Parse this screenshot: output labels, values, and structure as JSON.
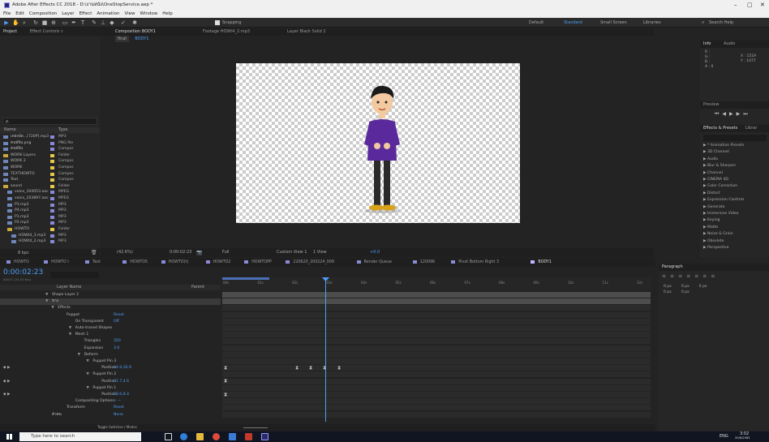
{
  "window": {
    "title": "Adobe After Effects CC 2018 - D:\\งานหนัง\\OneStopService.aep *",
    "controls": [
      "–",
      "▢",
      "✕"
    ]
  },
  "menu": [
    "File",
    "Edit",
    "Composition",
    "Layer",
    "Effect",
    "Animation",
    "View",
    "Window",
    "Help"
  ],
  "toolbar": {
    "snapping": "Snapping",
    "workspaces": [
      "Default",
      "Standard",
      "Small Screen",
      "Libraries"
    ],
    "search": "Search Help"
  },
  "project_panel": {
    "title": "Project",
    "effect_controls": "Effect Controls ร",
    "search_placeholder": "ρ.",
    "columns": [
      "Name",
      "Type"
    ],
    "items": [
      {
        "name": "เหล่งนัด...[720P].mp3",
        "type": "MP3",
        "color": "#8a8ad6",
        "indent": 0
      },
      {
        "name": "คนท์ลิน.png",
        "type": "PNG file",
        "color": "#8a8ad6",
        "indent": 0
      },
      {
        "name": "คนท์ลิน",
        "type": "Compos",
        "color": "#8a8ad6",
        "indent": 0
      },
      {
        "name": "WORK Layers",
        "type": "Folder",
        "color": "#e6c84a",
        "indent": 0
      },
      {
        "name": "WORK 2",
        "type": "Compos",
        "color": "#e6c84a",
        "indent": 0
      },
      {
        "name": "WORK",
        "type": "Compos",
        "color": "#e6c84a",
        "indent": 0
      },
      {
        "name": "TEXTHOWTO",
        "type": "Compos",
        "color": "#e6c84a",
        "indent": 0
      },
      {
        "name": "Text",
        "type": "Compos",
        "color": "#e6c84a",
        "indent": 0
      },
      {
        "name": "sound",
        "type": "Folder",
        "color": "#e6c84a",
        "indent": 0
      },
      {
        "name": "voice_104053.aac",
        "type": "MPEG",
        "color": "#8a8ad6",
        "indent": 1
      },
      {
        "name": "voice_103897.aac",
        "type": "MPEG",
        "color": "#8a8ad6",
        "indent": 1
      },
      {
        "name": "P3.mp3",
        "type": "MP3",
        "color": "#8a8ad6",
        "indent": 1
      },
      {
        "name": "P4.mp3",
        "type": "MP3",
        "color": "#8a8ad6",
        "indent": 1
      },
      {
        "name": "P1.mp3",
        "type": "MP3",
        "color": "#8a8ad6",
        "indent": 1
      },
      {
        "name": "P2.mp3",
        "type": "MP3",
        "color": "#8a8ad6",
        "indent": 1
      },
      {
        "name": "HOWTO",
        "type": "Folder",
        "color": "#e6c84a",
        "indent": 1
      },
      {
        "name": "HOWt4_3.mp3",
        "type": "MP3",
        "color": "#8a8ad6",
        "indent": 2
      },
      {
        "name": "HOWt4_2.mp3",
        "type": "MP3",
        "color": "#8a8ad6",
        "indent": 2
      }
    ],
    "bpc": "8 bpc"
  },
  "comp_viewer": {
    "tabs": [
      "Composition BODY1",
      "Footage HOWt4_2.mp3",
      "Layer Black Solid 2"
    ],
    "breadcrumb": [
      "final",
      "BODY1"
    ],
    "footer": {
      "zoom": "(42.6%)",
      "timecode": "0:00:02:23",
      "resolution": "Full",
      "view": "Custom View 1",
      "views": "1 View",
      "offset": "+0.0"
    }
  },
  "right_panel": {
    "info": "Info",
    "audio": "Audio",
    "rgb": [
      "R :",
      "G :",
      "B :",
      "A : 0"
    ],
    "xy": [
      "X : 1519",
      "Y : 1077"
    ],
    "preview": "Preview",
    "effects_presets": "Effects & Presets",
    "libraries": "Librar",
    "effects": [
      "* Animation Presets",
      "3D Channel",
      "Audio",
      "Blur & Sharpen",
      "Channel",
      "CINEMA 4D",
      "Color Correction",
      "Distort",
      "Expression Controls",
      "Generate",
      "Immersive Video",
      "Keying",
      "Matte",
      "Noise & Grain",
      "Obsolete",
      "Perspective"
    ],
    "paragraph": "Paragraph",
    "para_values": [
      "0 px",
      "0 px",
      "0 px",
      "0 px",
      "0 px"
    ]
  },
  "timeline": {
    "tabs": [
      "HOWTO",
      "HOWTO I",
      "Text",
      "HOWTO5",
      "HOWTO(t)",
      "HOWTO2",
      "HOWTOPP",
      "220620_200224_009",
      "Render Queue",
      "120096",
      "Pivot Bottom Right 3",
      "BODY1"
    ],
    "timecode": "0:00:02:23",
    "fps": "00071 (25.00 fps)",
    "col_layer": "Layer Name",
    "col_parent": "Parent",
    "ticks": [
      "00s",
      "01s",
      "02s",
      "03s",
      "04s",
      "05s",
      "06s",
      "07s",
      "08s",
      "09s",
      "10s",
      "11s",
      "12s"
    ],
    "rows": [
      {
        "label": "Shape Layer 2",
        "indent": 20,
        "value": "",
        "kf": false
      },
      {
        "label": "ขาง",
        "indent": 20,
        "value": "",
        "kf": false,
        "sel": true
      },
      {
        "label": "Effects",
        "indent": 24,
        "value": "",
        "kf": false
      },
      {
        "label": "Puppet",
        "indent": 30,
        "value": "Reset",
        "kf": false
      },
      {
        "label": "On Transparent",
        "indent": 36,
        "value": "Off",
        "kf": false
      },
      {
        "label": "Auto-traced Shapes",
        "indent": 36,
        "value": "",
        "kf": false
      },
      {
        "label": "Mesh 1",
        "indent": 36,
        "value": "",
        "kf": false
      },
      {
        "label": "Triangles",
        "indent": 42,
        "value": "350",
        "kf": false
      },
      {
        "label": "Expansion",
        "indent": 42,
        "value": "3.0",
        "kf": false
      },
      {
        "label": "Deform",
        "indent": 42,
        "value": "",
        "kf": false
      },
      {
        "label": "Puppet Pin 3",
        "indent": 48,
        "value": "",
        "kf": false
      },
      {
        "label": "Position",
        "indent": 54,
        "value": "44.9,26.9",
        "kf": true
      },
      {
        "label": "Puppet Pin 2",
        "indent": 48,
        "value": "",
        "kf": false
      },
      {
        "label": "Position",
        "indent": 54,
        "value": "61.7,4.6",
        "kf": true
      },
      {
        "label": "Puppet Pin 1",
        "indent": 48,
        "value": "",
        "kf": false
      },
      {
        "label": "Position",
        "indent": 54,
        "value": "58.6,8.4",
        "kf": true
      },
      {
        "label": "Compositing Options",
        "indent": 36,
        "value": "+ −",
        "kf": false
      },
      {
        "label": "Transform",
        "indent": 30,
        "value": "Reset",
        "kf": false
      },
      {
        "label": "ตัวคน",
        "indent": 20,
        "value": "None",
        "kf": false
      }
    ],
    "toggle": "Toggle Switches / Modes",
    "parent_none": "None"
  },
  "taskbar": {
    "search": "Type here to search",
    "tray": "ENG",
    "time": "3:02",
    "date": "20/6/2563"
  }
}
